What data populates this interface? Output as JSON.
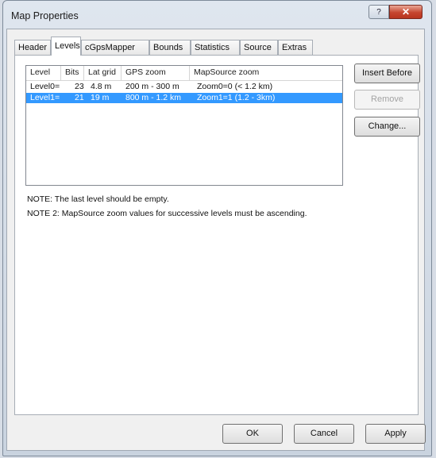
{
  "window": {
    "title": "Map Properties",
    "help_label": "?",
    "close_label": "✕"
  },
  "tabs": [
    {
      "label": "Header"
    },
    {
      "label": "Levels"
    },
    {
      "label": "cGpsMapper"
    },
    {
      "label": "Bounds"
    },
    {
      "label": "Statistics"
    },
    {
      "label": "Source"
    },
    {
      "label": "Extras"
    }
  ],
  "active_tab": "Levels",
  "levels_table": {
    "columns": [
      "Level",
      "Bits",
      "Lat grid",
      "GPS zoom",
      "MapSource zoom"
    ],
    "rows": [
      {
        "level": "Level0=",
        "bits": "23",
        "lat_grid": "4.8 m",
        "gps_zoom": "200 m - 300 m",
        "mapsource_zoom": "Zoom0=0 (< 1.2 km)",
        "selected": false
      },
      {
        "level": "Level1=",
        "bits": "21",
        "lat_grid": "19 m",
        "gps_zoom": "800 m - 1.2 km",
        "mapsource_zoom": "Zoom1=1 (1.2 - 3km)",
        "selected": true
      }
    ]
  },
  "side_buttons": {
    "insert_before": "Insert Before",
    "remove": "Remove",
    "change": "Change..."
  },
  "notes": {
    "note1": "NOTE: The last level should be empty.",
    "note2": "NOTE 2: MapSource zoom values for successive levels must be ascending."
  },
  "dialog_buttons": {
    "ok": "OK",
    "cancel": "Cancel",
    "apply": "Apply"
  },
  "colors": {
    "selection": "#3399ff",
    "close_button": "#c6452f"
  }
}
